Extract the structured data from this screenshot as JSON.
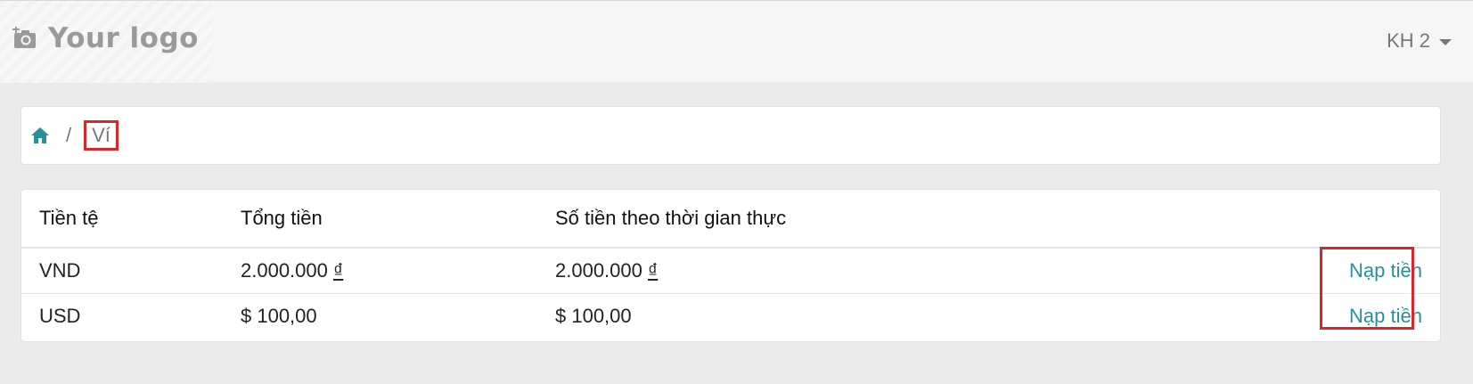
{
  "header": {
    "logo_text": "Your logo",
    "logo_icon": "camera-add-icon",
    "user_label": "KH 2"
  },
  "breadcrumb": {
    "home_icon": "home-icon",
    "separator": "/",
    "current": "Ví"
  },
  "wallet_table": {
    "headers": [
      "Tiền tệ",
      "Tổng tiền",
      "Số tiền theo thời gian thực"
    ],
    "rows": [
      {
        "currency": "VND",
        "total": "2.000.000 ",
        "total_symbol": "₫",
        "realtime": "2.000.000 ",
        "realtime_symbol": "₫",
        "action": "Nạp tiền"
      },
      {
        "currency": "USD",
        "total": "$ 100,00",
        "total_symbol": "",
        "realtime": "$ 100,00",
        "realtime_symbol": "",
        "action": "Nạp tiền"
      }
    ]
  },
  "colors": {
    "accent": "#2a8f9c",
    "highlight_border": "#d9262b",
    "background": "#ebebeb"
  }
}
